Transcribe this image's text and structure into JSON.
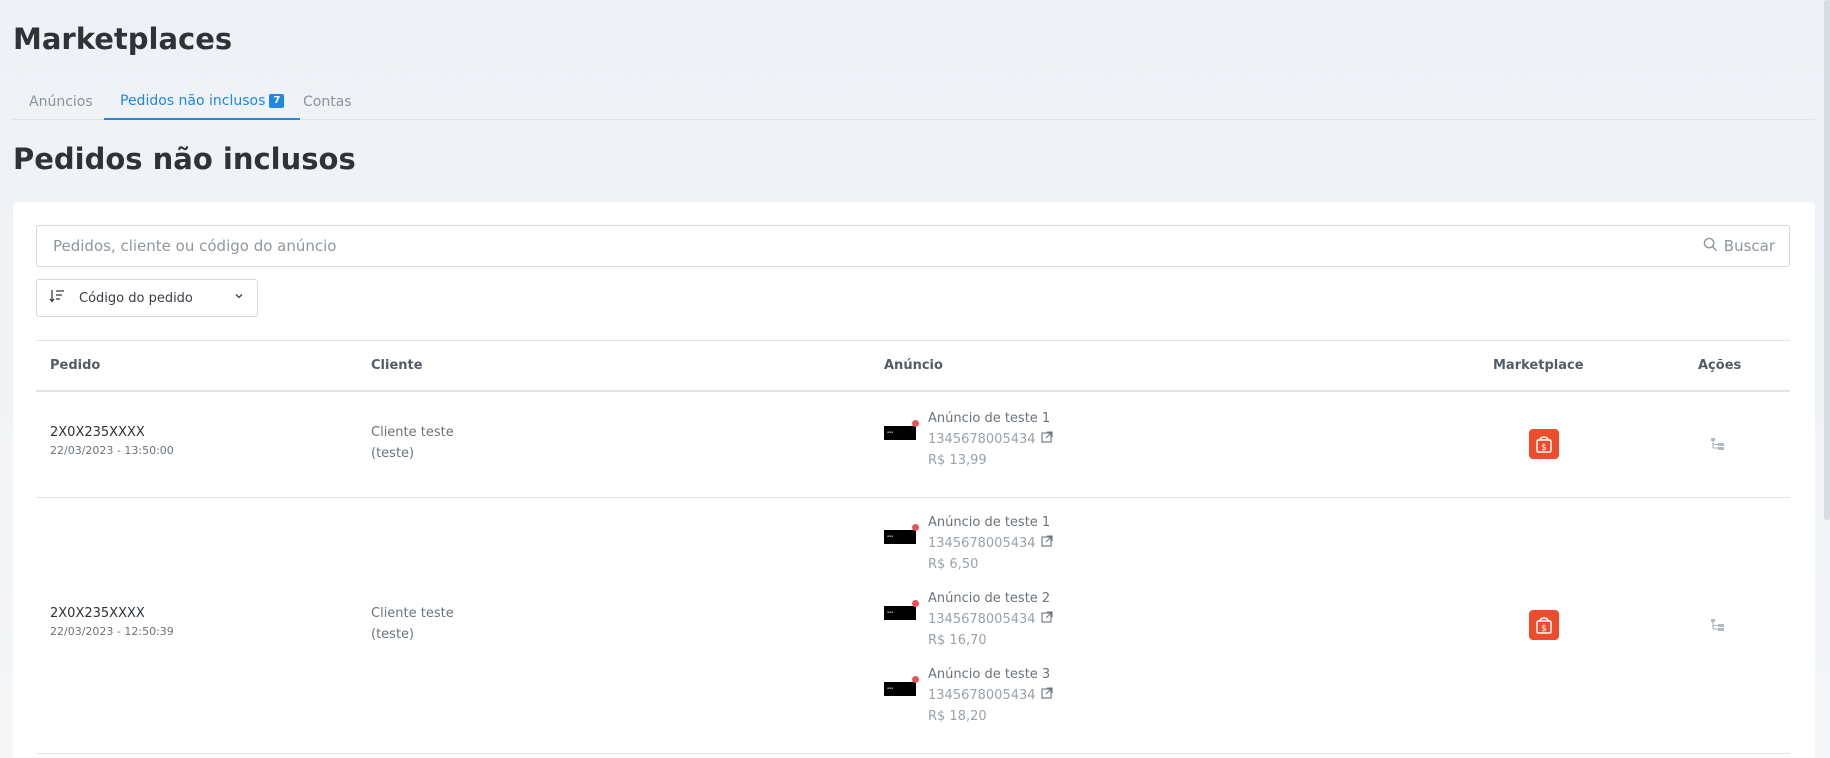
{
  "app": {
    "title": "Marketplaces"
  },
  "tabs": [
    {
      "label": "Anúncios"
    },
    {
      "label": "Pedidos não inclusos",
      "badge": "7"
    },
    {
      "label": "Contas"
    }
  ],
  "section": {
    "title": "Pedidos não inclusos"
  },
  "search": {
    "placeholder": "Pedidos, cliente ou código do anúncio",
    "button_label": "Buscar"
  },
  "sort": {
    "label": "Código do pedido"
  },
  "table": {
    "headers": [
      "Pedido",
      "Cliente",
      "Anúncio",
      "Marketplace",
      "Ações"
    ],
    "rows": [
      {
        "order_code": "2X0X235XXXX",
        "order_date": "22/03/2023 - 13:50:00",
        "client_name": "Cliente teste",
        "client_detail": "(teste)",
        "ads": [
          {
            "name": "Anúncio de teste 1",
            "code": "1345678005434",
            "price": "R$ 13,99"
          }
        ],
        "marketplace_icon": "shopee-bag-icon"
      },
      {
        "order_code": "2X0X235XXXX",
        "order_date": "22/03/2023 - 12:50:39",
        "client_name": "Cliente teste",
        "client_detail": "(teste)",
        "ads": [
          {
            "name": "Anúncio de teste 1",
            "code": "1345678005434",
            "price": "R$ 6,50"
          },
          {
            "name": "Anúncio de teste 2",
            "code": "1345678005434",
            "price": "R$ 16,70"
          },
          {
            "name": "Anúncio de teste 3",
            "code": "1345678005434",
            "price": "R$ 18,20"
          }
        ],
        "marketplace_icon": "shopee-bag-icon"
      }
    ]
  },
  "colors": {
    "accent": "#1e88e5",
    "marketplace": "#ee4d2d",
    "status_dot": "#e8525a"
  }
}
